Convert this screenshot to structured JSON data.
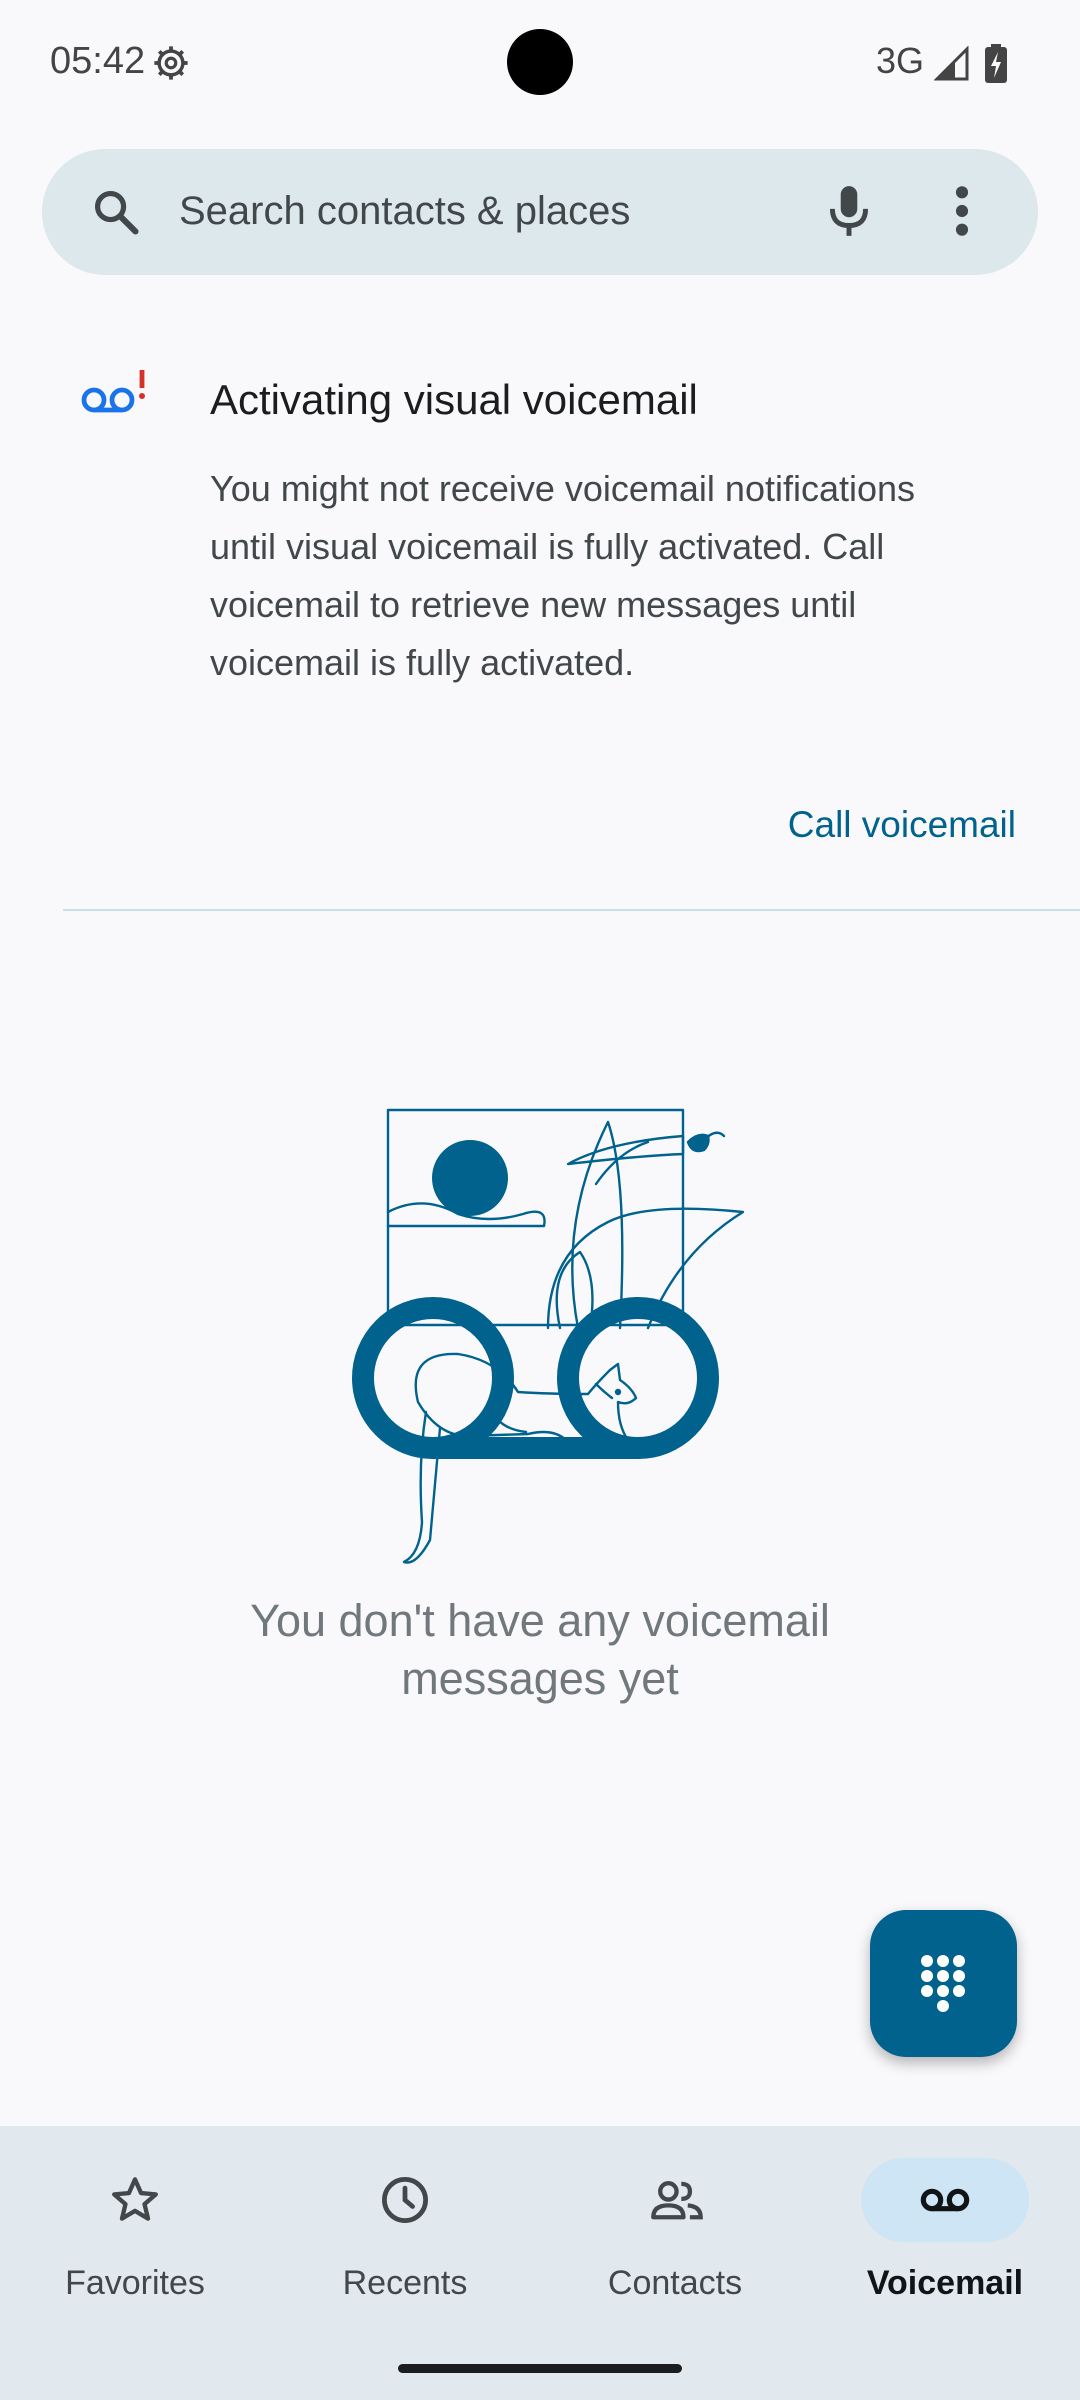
{
  "status_bar": {
    "time": "05:42",
    "network": "3G"
  },
  "search": {
    "placeholder": "Search contacts & places",
    "icons": [
      "search-icon",
      "mic-icon",
      "more-vert-icon"
    ]
  },
  "banner": {
    "icon": "voicemail-alert-icon",
    "title": "Activating visual voicemail",
    "body": "You might not receive voicemail notifications until visual voicemail is fully activated. Call voicemail to retrieve new messages until voicemail is fully activated.",
    "action_label": "Call voicemail"
  },
  "empty_state": {
    "message": "You don't have any voicemail messages yet"
  },
  "fab": {
    "icon": "dialpad-icon"
  },
  "bottom_nav": {
    "items": [
      {
        "label": "Favorites",
        "icon": "star-icon",
        "active": false
      },
      {
        "label": "Recents",
        "icon": "clock-icon",
        "active": false
      },
      {
        "label": "Contacts",
        "icon": "people-icon",
        "active": false
      },
      {
        "label": "Voicemail",
        "icon": "voicemail-icon",
        "active": true
      }
    ]
  },
  "colors": {
    "accent": "#00628d",
    "search_bg": "#dce8ec",
    "nav_bg": "#e1e9ee",
    "alert_red": "#d93025"
  }
}
